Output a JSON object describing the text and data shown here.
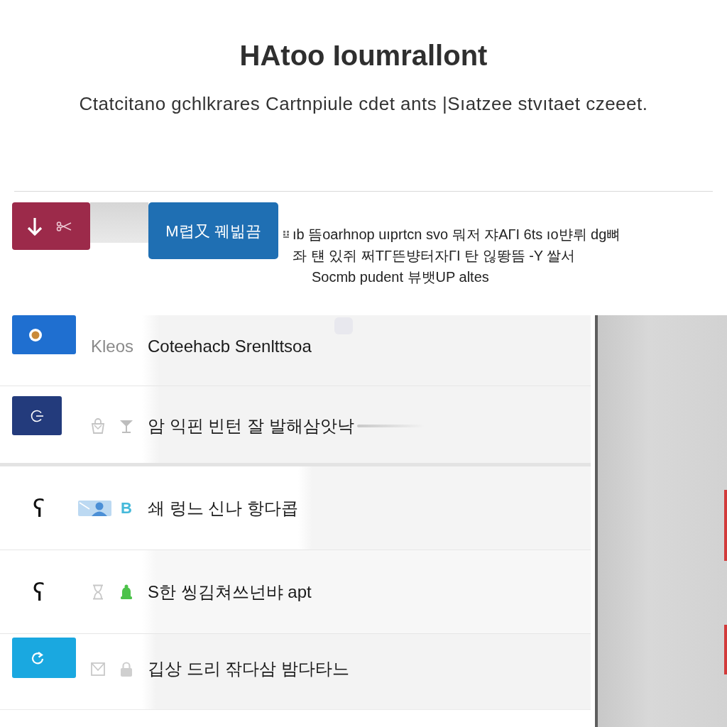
{
  "header": {
    "title": "HAtoo Ioumrallont",
    "subtitle": "Ctatcitano gchlkrares Cartnpiule cdet ants |Sıatzee stvıtaet czeeet."
  },
  "toolbar": {
    "buttons": [
      {
        "kind": "icon",
        "color": "#9c2a4a"
      },
      {
        "kind": "text",
        "label": "M렵又 꿰빎끔",
        "color": "#1f6fb3"
      }
    ],
    "description": [
      "ıb 뜸oarhnop uıprtcn svo 뭐저 쟈AΓI 6ts ıo뱐뤼 dg뼈",
      "좌 턘 있쥐 쩌TΓ뜬뱡터자ΓI 탄 읺뙁뜸 -Y 쌀서",
      "Socmb pudent 뷰뱃UP altes"
    ]
  },
  "list": {
    "items": [
      {
        "kind": "tile",
        "color": "#1f6fd0",
        "prefix": "Kleos",
        "label": "Coteehacb Srenlttsoa"
      },
      {
        "kind": "tile",
        "color": "#233b7c",
        "label": "암 익핀 빈턴 잘 발해삼앗낙"
      },
      {
        "kind": "glyph",
        "glyph": "ʕ",
        "badge": "B",
        "label": "쇄 렁느 신나 항다콥"
      },
      {
        "kind": "glyph",
        "glyph": "ʕ",
        "label": "S한 씽김쳐쓰넌뱌 apt"
      },
      {
        "kind": "tile",
        "color": "#1aa8e0",
        "label": "깁상 드리 잒다삼 밤다타느"
      }
    ]
  }
}
